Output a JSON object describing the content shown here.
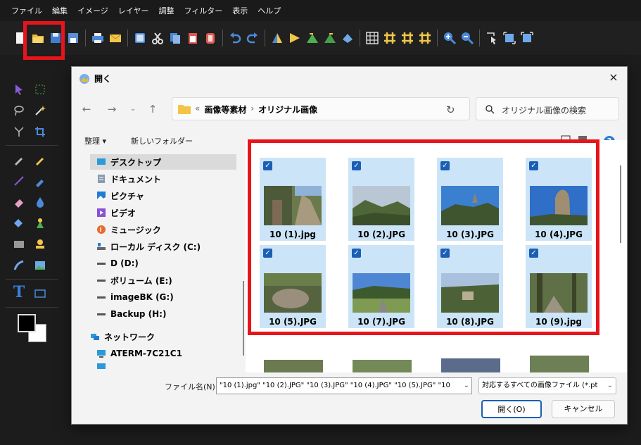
{
  "menubar": {
    "items": [
      "ファイル",
      "編集",
      "イメージ",
      "レイヤー",
      "調整",
      "フィルター",
      "表示",
      "ヘルプ"
    ]
  },
  "toolbar": {
    "icons": [
      "new-icon",
      "open-folder-icon",
      "save-icon",
      "save-as-icon",
      "print-icon",
      "email-icon",
      "duplicate-icon",
      "cut-icon",
      "copy-icon",
      "paste-icon",
      "paste-new-icon",
      "undo-icon",
      "redo-icon",
      "flip-horizontal-icon",
      "flip-vertical-icon",
      "rotate-left-icon",
      "rotate-right-icon",
      "free-rotate-icon",
      "grid-icon",
      "grid-toggle-icon",
      "guides-icon",
      "snap-icon",
      "zoom-in-icon",
      "zoom-out-icon",
      "select-icon",
      "fit-icon",
      "actual-size-icon"
    ]
  },
  "dialog": {
    "title": "開く",
    "close": "×",
    "address": {
      "prefix": "«",
      "crumbs": [
        "画像等素材",
        "オリジナル画像"
      ],
      "separator": "›"
    },
    "search_placeholder": "オリジナル画像の検索",
    "organize": "整理 ▾",
    "new_folder": "新しいフォルダー",
    "help": "?",
    "nav_items": [
      {
        "label": "デスクトップ",
        "icon": "desktop-icon"
      },
      {
        "label": "ドキュメント",
        "icon": "documents-icon"
      },
      {
        "label": "ピクチャ",
        "icon": "pictures-icon"
      },
      {
        "label": "ビデオ",
        "icon": "videos-icon"
      },
      {
        "label": "ミュージック",
        "icon": "music-icon"
      },
      {
        "label": "ローカル ディスク (C:)",
        "icon": "local-disk-icon"
      },
      {
        "label": "D (D:)",
        "icon": "drive-icon"
      },
      {
        "label": "ボリューム (E:)",
        "icon": "drive-icon"
      },
      {
        "label": "imageBK (G:)",
        "icon": "drive-icon"
      },
      {
        "label": "Backup (H:)",
        "icon": "drive-icon"
      },
      {
        "label": "ネットワーク",
        "icon": "network-icon"
      },
      {
        "label": "ATERM-7C21C1",
        "icon": "computer-icon"
      }
    ],
    "files": [
      {
        "name": "10 (1).jpg",
        "selected": true
      },
      {
        "name": "10 (2).JPG",
        "selected": true
      },
      {
        "name": "10 (3).JPG",
        "selected": true
      },
      {
        "name": "10 (4).JPG",
        "selected": true
      },
      {
        "name": "10 (5).JPG",
        "selected": true
      },
      {
        "name": "10 (7).JPG",
        "selected": true
      },
      {
        "name": "10 (8).JPG",
        "selected": true
      },
      {
        "name": "10 (9).jpg",
        "selected": true
      }
    ],
    "check_mark": "✓",
    "filename_label": "ファイル名(N):",
    "filename_value": "\"10 (1).jpg\" \"10 (2).JPG\" \"10 (3).JPG\" \"10 (4).JPG\" \"10 (5).JPG\" \"10",
    "filetype_value": "対応するすべての画像ファイル (*.pt",
    "open_button": "開く(O)",
    "cancel_button": "キャンセル"
  },
  "colors": {
    "highlight": "#e8141b",
    "selection": "#cce4f7",
    "accent": "#1a5fb4"
  }
}
